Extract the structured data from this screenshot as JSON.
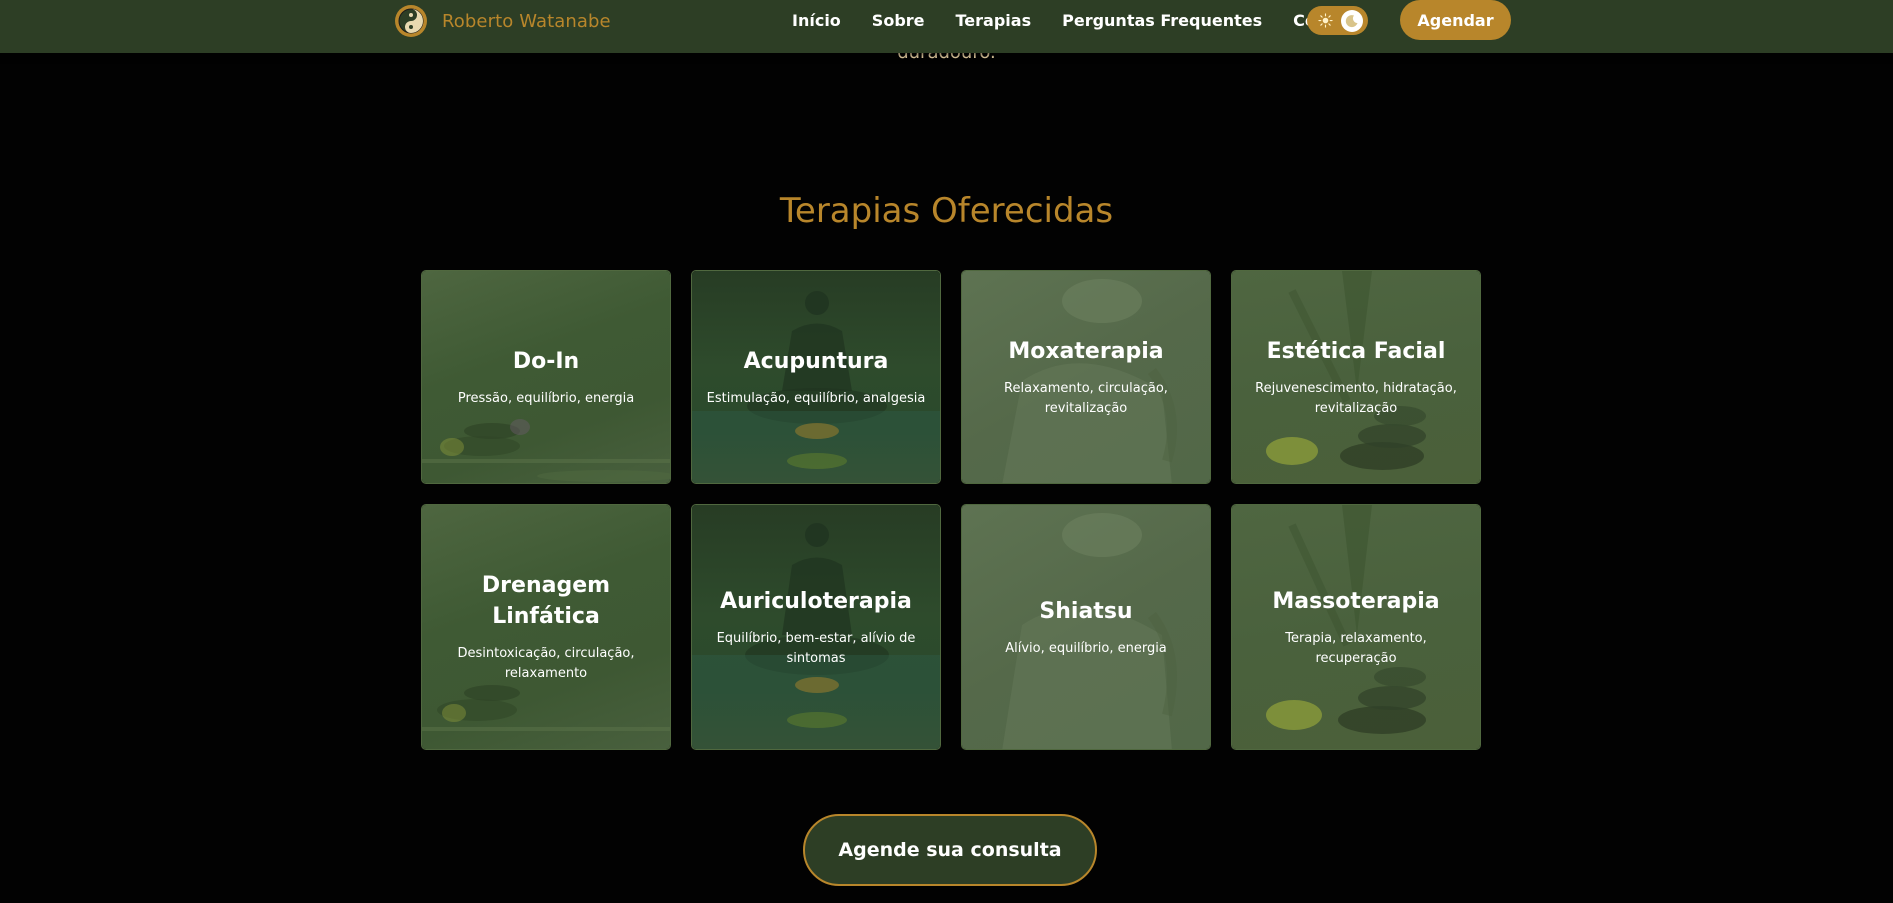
{
  "navbar": {
    "brand_name": "Roberto Watanabe",
    "logo_icon": "yin-yang-icon",
    "links": [
      "Início",
      "Sobre",
      "Terapias",
      "Perguntas Frequentes",
      "Contato"
    ],
    "theme_toggle": {
      "left_icon": "sun-icon",
      "knob_icon": "moon-icon"
    },
    "cta_label": "Agendar"
  },
  "previous_section_tail": "duradouro.",
  "therapies": {
    "title": "Terapias Oferecidas",
    "cards": [
      {
        "title": "Do-In",
        "description": "Pressão, equilíbrio, energia"
      },
      {
        "title": "Acupuntura",
        "description": "Estimulação, equilíbrio, analgesia"
      },
      {
        "title": "Moxaterapia",
        "description": "Relaxamento, circulação, revitalização"
      },
      {
        "title": "Estética Facial",
        "description": "Rejuvenescimento, hidratação, revitalização"
      },
      {
        "title": "Drenagem Linfática",
        "description": "Desintoxicação, circulação, relaxamento"
      },
      {
        "title": "Auriculoterapia",
        "description": "Equilíbrio, bem-estar, alívio de sintomas"
      },
      {
        "title": "Shiatsu",
        "description": "Alívio, equilíbrio, energia"
      },
      {
        "title": "Massoterapia",
        "description": "Terapia, relaxamento, recuperação"
      }
    ],
    "cta_label": "Agende sua consulta"
  },
  "colors": {
    "navbar_bg": "#2d3e25",
    "accent_gold": "#b8862b",
    "page_bg": "#020202",
    "card_border": "#50683f"
  }
}
